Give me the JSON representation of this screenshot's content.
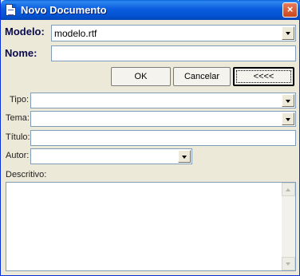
{
  "window": {
    "title": "Novo Documento",
    "close_glyph": "×"
  },
  "form": {
    "modelo_label": "Modelo:",
    "modelo_value": "modelo.rtf",
    "nome_label": "Nome:",
    "nome_value": "",
    "tipo_label": "Tipo:",
    "tipo_value": "",
    "tema_label": "Tema:",
    "tema_value": "",
    "titulo_label": "Título:",
    "titulo_value": "",
    "autor_label": "Autor:",
    "autor_value": "",
    "descritivo_label": "Descritivo:"
  },
  "buttons": {
    "ok": "OK",
    "cancel": "Cancelar",
    "toggle": "<<<<"
  },
  "icons": [
    "document-icon",
    "close-icon",
    "chevron-down-icon",
    "scroll-up-icon",
    "scroll-down-icon"
  ],
  "colors": {
    "titlebar": "#0a5fdb",
    "window_bg": "#ece9d8",
    "field_border": "#7f9db9",
    "close_button": "#d65a2e"
  }
}
